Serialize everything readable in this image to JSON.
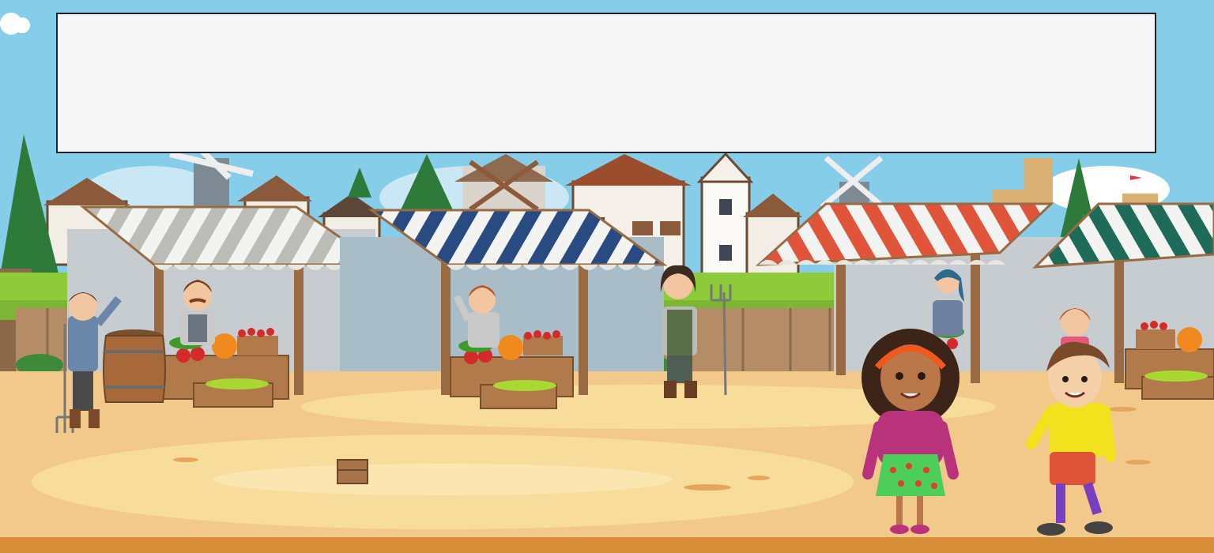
{
  "scene": {
    "name": "medieval-market",
    "colors": {
      "sky": "#86cdea",
      "grass": "#8fca3a",
      "ground": "#f2c98a",
      "ground_light": "#f8dc9c",
      "fence": "#b48c66",
      "awning_white": "#d9d9d6",
      "awning_blue": "#2a4a82",
      "awning_red": "#e0553a",
      "awning_green": "#1f6b5a"
    },
    "stalls": [
      "white-striped-stall",
      "blue-striped-stall",
      "red-striped-stall",
      "green-striped-stall"
    ],
    "characters": [
      "farmer-with-pitchfork",
      "mustached-vendor",
      "redhead-vendor",
      "villager-with-pitchfork",
      "woman-vendor",
      "red-haired-child",
      "girl-with-headband",
      "boy-in-yellow-shirt"
    ],
    "items": [
      "wooden-barrel",
      "small-wooden-crate"
    ]
  },
  "dialog": {
    "text": ""
  }
}
